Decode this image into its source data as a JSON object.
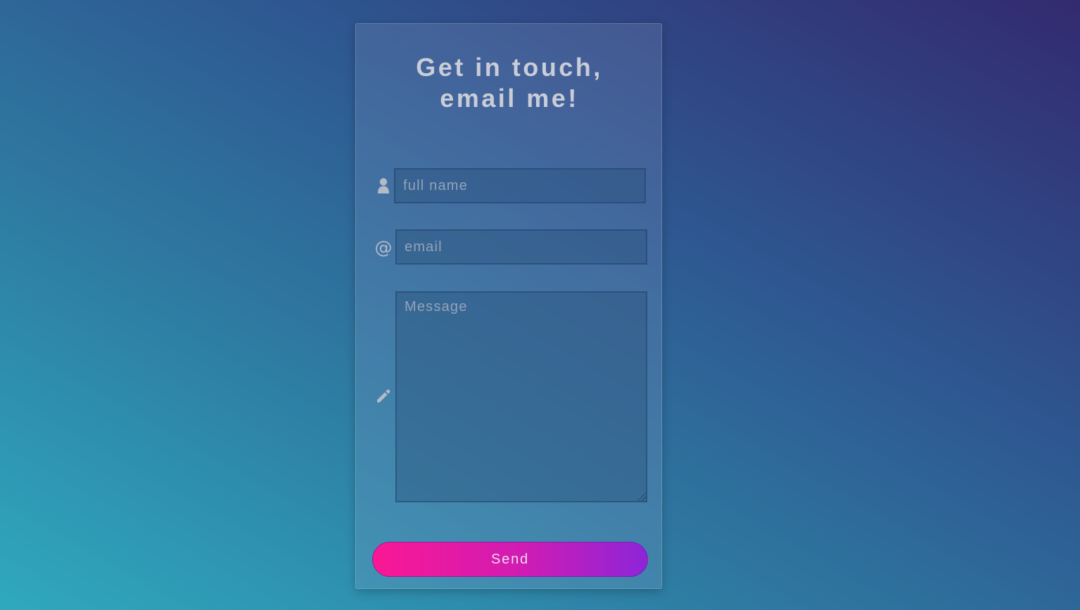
{
  "form": {
    "title_line1": "Get in touch,",
    "title_line2": "email me!",
    "name_placeholder": "full name",
    "email_placeholder": "email",
    "email_icon_glyph": "@",
    "message_placeholder": "Message",
    "send_label": "Send"
  },
  "icons": {
    "name": "user-icon",
    "email": "at-icon",
    "message": "pencil-icon"
  },
  "colors": {
    "background_start": "#2fa9bd",
    "background_end": "#332a70",
    "button_start": "#fa1894",
    "button_end": "#8d25d8",
    "text": "#c9cdd8"
  }
}
